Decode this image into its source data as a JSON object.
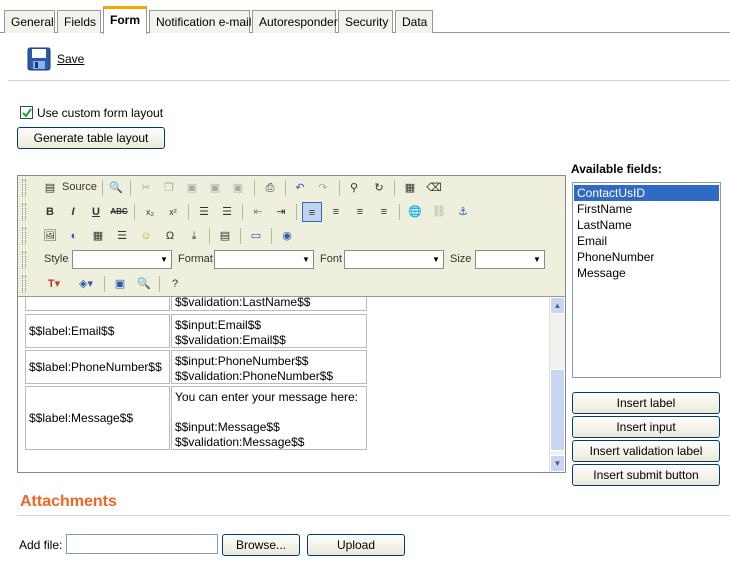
{
  "tabs": [
    "General",
    "Fields",
    "Form",
    "Notification e-mail",
    "Autoresponder",
    "Security",
    "Data"
  ],
  "active_tab": "Form",
  "save_label": "Save",
  "custom_layout_label": "Use custom form layout",
  "custom_layout_checked": true,
  "generate_button": "Generate table layout",
  "editor": {
    "source_label": "Source",
    "style_label": "Style",
    "format_label": "Format",
    "font_label": "Font",
    "size_label": "Size",
    "rows": [
      {
        "label": "",
        "input": "$$validation:LastName$$"
      },
      {
        "label": "$$label:Email$$",
        "input": "$$input:Email$$",
        "validation": "$$validation:Email$$"
      },
      {
        "label": "$$label:PhoneNumber$$",
        "input": "$$input:PhoneNumber$$",
        "validation": "$$validation:PhoneNumber$$"
      },
      {
        "label": "$$label:Message$$",
        "intro": "You can enter your message here:",
        "input": "$$input:Message$$",
        "validation": "$$validation:Message$$"
      }
    ]
  },
  "available_fields_label": "Available fields:",
  "available_fields": [
    "ContactUsID",
    "FirstName",
    "LastName",
    "Email",
    "PhoneNumber",
    "Message"
  ],
  "selected_field": "ContactUsID",
  "buttons": {
    "insert_label": "Insert label",
    "insert_input": "Insert input",
    "insert_validation": "Insert validation label",
    "insert_submit": "Insert submit button"
  },
  "attachments_heading": "Attachments",
  "add_file_label": "Add file:",
  "browse_button": "Browse...",
  "upload_button": "Upload",
  "colors": {
    "accent": "#f26522",
    "tab_highlight": "#f0a900",
    "selection": "#316ac5"
  }
}
